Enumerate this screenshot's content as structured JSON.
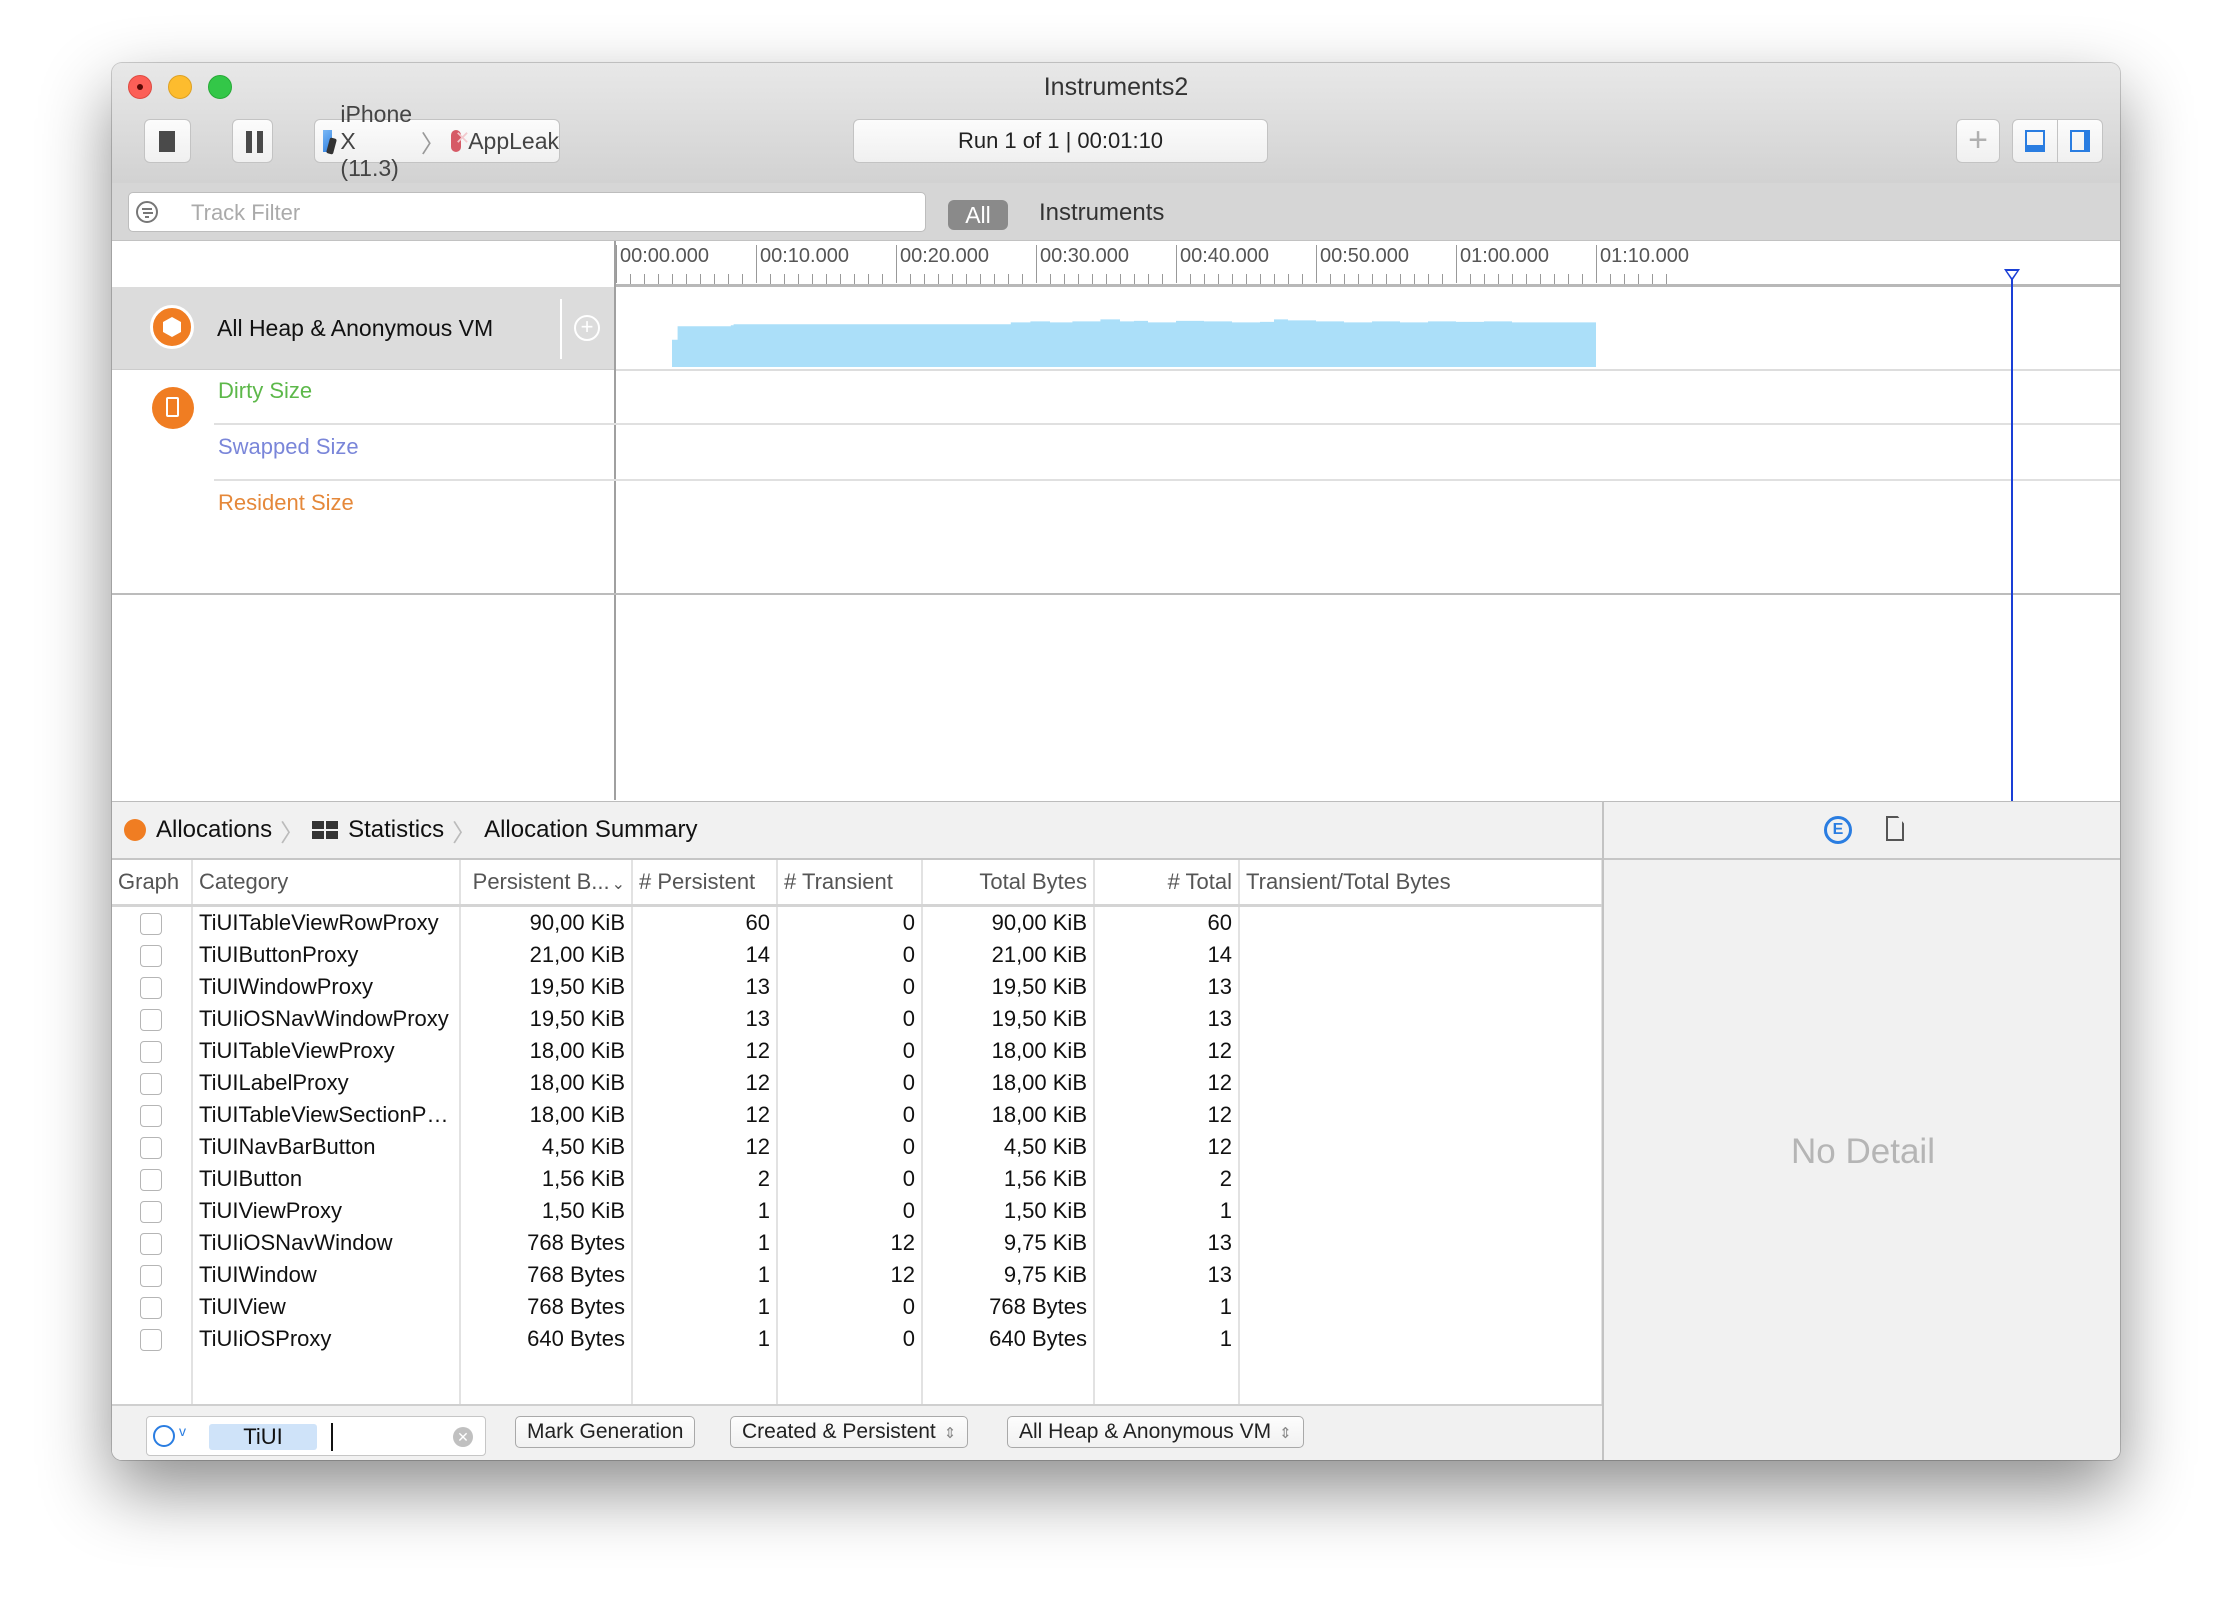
{
  "window": {
    "title": "Instruments2"
  },
  "toolbar": {
    "stop_icon": "stop-icon",
    "pause_icon": "pause-icon",
    "device": "iPhone X (11.3)",
    "app": "AppLeak",
    "run_status": "Run 1 of 1  |  00:01:10",
    "add_label": "+"
  },
  "filterbar": {
    "track_filter_placeholder": "Track Filter",
    "tabs": [
      "All",
      "Instruments"
    ],
    "active_tab": "All"
  },
  "timeline": {
    "ruler_labels": [
      "00:00.000",
      "00:10.000",
      "00:20.000",
      "00:30.000",
      "00:40.000",
      "00:50.000",
      "01:00.000",
      "01:10.000"
    ],
    "playhead_time": "01:10",
    "track": {
      "label": "All Heap & Anonymous VM",
      "subtracks": [
        {
          "label": "Dirty Size",
          "color": "#5db84a"
        },
        {
          "label": "Swapped Size",
          "color": "#7a86d9"
        },
        {
          "label": "Resident Size",
          "color": "#e5883a"
        }
      ]
    },
    "graph_color": "#abdff9",
    "heap_graph": {
      "x_seconds": [
        0,
        3.8,
        4.0,
        4.4,
        8.2,
        8.4,
        28.0,
        28.2,
        29.6,
        31.0,
        32.6,
        34.6,
        36.0,
        37.0,
        38.0,
        40.0,
        42.0,
        44.0,
        46.0,
        47.0,
        48.0,
        50.0,
        52.0,
        54.0,
        56.0,
        58.0,
        60.0,
        62.0,
        64.0,
        66.0,
        70.0
      ],
      "relative_level": [
        0,
        0,
        0.55,
        0.82,
        0.84,
        0.86,
        0.86,
        0.9,
        0.92,
        0.9,
        0.92,
        0.96,
        0.92,
        0.93,
        0.9,
        0.93,
        0.92,
        0.9,
        0.91,
        0.96,
        0.94,
        0.92,
        0.9,
        0.92,
        0.9,
        0.92,
        0.91,
        0.92,
        0.9,
        0.9,
        0.9
      ]
    }
  },
  "detail": {
    "breadcrumb": [
      "Allocations",
      "Statistics",
      "Allocation Summary"
    ],
    "columns": [
      "Graph",
      "Category",
      "Persistent B...",
      "# Persistent",
      "# Transient",
      "Total Bytes",
      "# Total",
      "Transient/Total Bytes"
    ],
    "sort_column": "Persistent B...",
    "rows": [
      {
        "category": "TiUITableViewRowProxy",
        "persistent_bytes": "90,00 KiB",
        "persistent": "60",
        "transient": "0",
        "total_bytes": "90,00 KiB",
        "total": "60"
      },
      {
        "category": "TiUIButtonProxy",
        "persistent_bytes": "21,00 KiB",
        "persistent": "14",
        "transient": "0",
        "total_bytes": "21,00 KiB",
        "total": "14"
      },
      {
        "category": "TiUIWindowProxy",
        "persistent_bytes": "19,50 KiB",
        "persistent": "13",
        "transient": "0",
        "total_bytes": "19,50 KiB",
        "total": "13"
      },
      {
        "category": "TiUIiOSNavWindowProxy",
        "persistent_bytes": "19,50 KiB",
        "persistent": "13",
        "transient": "0",
        "total_bytes": "19,50 KiB",
        "total": "13"
      },
      {
        "category": "TiUITableViewProxy",
        "persistent_bytes": "18,00 KiB",
        "persistent": "12",
        "transient": "0",
        "total_bytes": "18,00 KiB",
        "total": "12"
      },
      {
        "category": "TiUILabelProxy",
        "persistent_bytes": "18,00 KiB",
        "persistent": "12",
        "transient": "0",
        "total_bytes": "18,00 KiB",
        "total": "12"
      },
      {
        "category": "TiUITableViewSectionPro...",
        "persistent_bytes": "18,00 KiB",
        "persistent": "12",
        "transient": "0",
        "total_bytes": "18,00 KiB",
        "total": "12"
      },
      {
        "category": "TiUINavBarButton",
        "persistent_bytes": "4,50 KiB",
        "persistent": "12",
        "transient": "0",
        "total_bytes": "4,50 KiB",
        "total": "12"
      },
      {
        "category": "TiUIButton",
        "persistent_bytes": "1,56 KiB",
        "persistent": "2",
        "transient": "0",
        "total_bytes": "1,56 KiB",
        "total": "2"
      },
      {
        "category": "TiUIViewProxy",
        "persistent_bytes": "1,50 KiB",
        "persistent": "1",
        "transient": "0",
        "total_bytes": "1,50 KiB",
        "total": "1"
      },
      {
        "category": "TiUIiOSNavWindow",
        "persistent_bytes": "768 Bytes",
        "persistent": "1",
        "transient": "12",
        "total_bytes": "9,75 KiB",
        "total": "13"
      },
      {
        "category": "TiUIWindow",
        "persistent_bytes": "768 Bytes",
        "persistent": "1",
        "transient": "12",
        "total_bytes": "9,75 KiB",
        "total": "13"
      },
      {
        "category": "TiUIView",
        "persistent_bytes": "768 Bytes",
        "persistent": "1",
        "transient": "0",
        "total_bytes": "768 Bytes",
        "total": "1"
      },
      {
        "category": "TiUIiOSProxy",
        "persistent_bytes": "640 Bytes",
        "persistent": "1",
        "transient": "0",
        "total_bytes": "640 Bytes",
        "total": "1"
      }
    ],
    "bottom_toolbar": {
      "search_token": "TiUI",
      "mark_generation": "Mark Generation",
      "lifespan_select": "Created & Persistent",
      "allocation_type_select": "All Heap & Anonymous VM"
    }
  },
  "inspector": {
    "empty_text": "No Detail"
  }
}
